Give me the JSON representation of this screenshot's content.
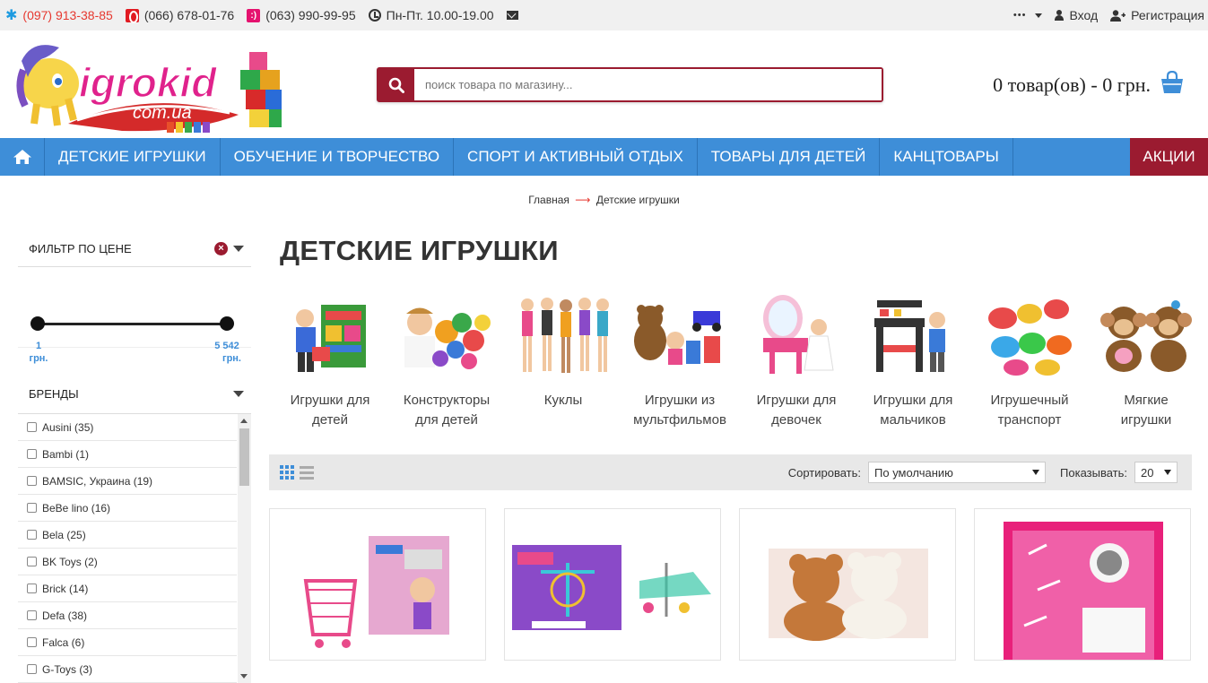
{
  "topbar": {
    "phones": [
      "(097) 913-38-85",
      "(066) 678-01-76",
      "(063) 990-99-95"
    ],
    "hours": "Пн-Пт. 10.00-19.00",
    "more": "•••",
    "login": "Вход",
    "register": "Регистрация"
  },
  "search": {
    "placeholder": "поиск товара по магазину..."
  },
  "cart": {
    "summary": "0 товар(ов) - 0 грн."
  },
  "nav": {
    "items": [
      "ДЕТСКИЕ ИГРУШКИ",
      "ОБУЧЕНИЕ И ТВОРЧЕСТВО",
      "СПОРТ И АКТИВНЫЙ ОТДЫХ",
      "ТОВАРЫ ДЛЯ ДЕТЕЙ",
      "КАНЦТОВАРЫ"
    ],
    "sale": "АКЦИИ"
  },
  "breadcrumb": {
    "home": "Главная",
    "arrow": "⟶",
    "current": "Детские игрушки"
  },
  "filter": {
    "price_title": "ФИЛЬТР ПО ЦЕНЕ",
    "min_value": "1",
    "max_value": "5 542",
    "currency": "грн.",
    "brands_title": "БРЕНДЫ",
    "brands": [
      "Ausini (35)",
      "Bambi (1)",
      "BAMSIC, Украина (19)",
      "BeBe lino (16)",
      "Bela (25)",
      "BK Toys (2)",
      "Brick (14)",
      "Defa (38)",
      "Falca (6)",
      "G-Toys (3)"
    ]
  },
  "page": {
    "title": "ДЕТСКИЕ ИГРУШКИ"
  },
  "categories": [
    {
      "line1": "Игрушки для",
      "line2": "детей"
    },
    {
      "line1": "Конструкторы",
      "line2": "для детей"
    },
    {
      "line1": "Куклы",
      "line2": ""
    },
    {
      "line1": "Игрушки из",
      "line2": "мультфильмов"
    },
    {
      "line1": "Игрушки для",
      "line2": "девочек"
    },
    {
      "line1": "Игрушки для",
      "line2": "мальчиков"
    },
    {
      "line1": "Игрушечный",
      "line2": "транспорт"
    },
    {
      "line1": "Мягкие",
      "line2": "игрушки"
    }
  ],
  "toolbar": {
    "sort_label": "Сортировать:",
    "sort_value": "По умолчанию",
    "show_label": "Показывать:",
    "show_value": "20"
  },
  "colors": {
    "accent_red": "#9b1b30",
    "nav_blue": "#3e8ed8"
  }
}
